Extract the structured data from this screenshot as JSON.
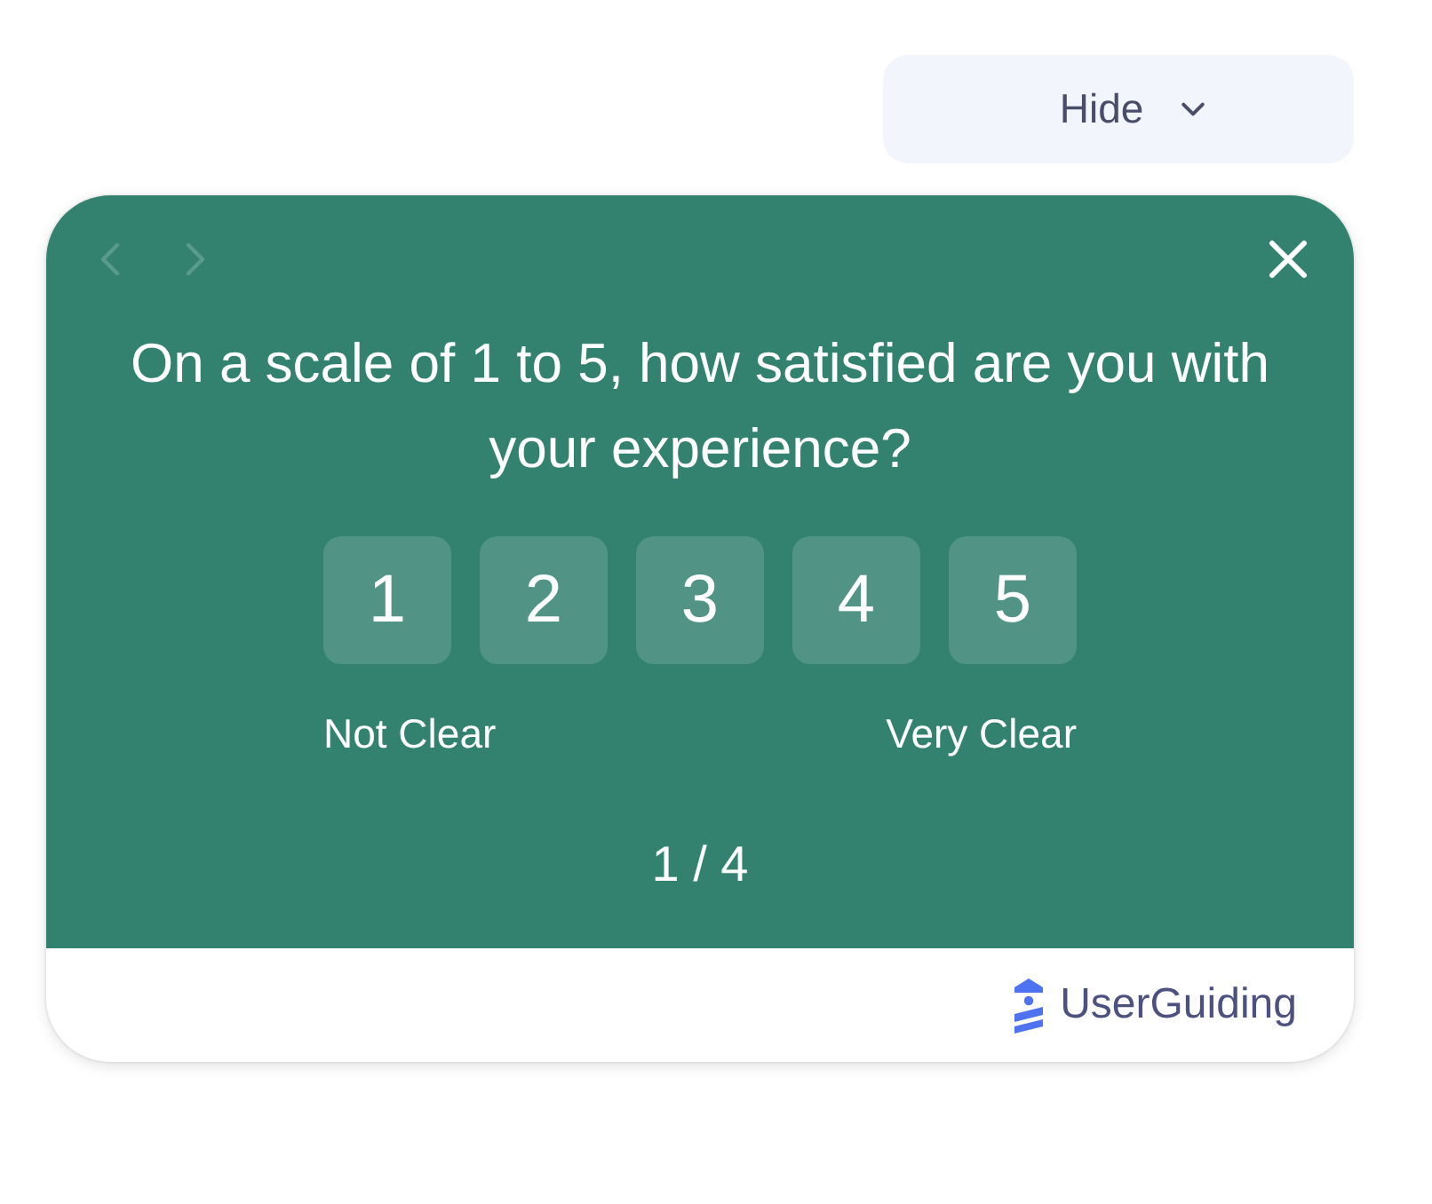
{
  "hide_button": {
    "label": "Hide"
  },
  "survey": {
    "nav": [
      {
        "kind": "previous",
        "disabled": true
      },
      {
        "kind": "next",
        "disabled": true
      }
    ],
    "question": "On a scale of 1 to 5, how satisfied are you with your experience?",
    "options": [
      {
        "label": "1",
        "selected": false
      },
      {
        "label": "2",
        "selected": false
      },
      {
        "label": "3",
        "selected": false
      },
      {
        "label": "4",
        "selected": false
      },
      {
        "label": "5",
        "selected": false
      }
    ],
    "scale_labels": {
      "low": "Not Clear",
      "high": "Very Clear"
    },
    "progress": "1 / 4"
  },
  "footer": {
    "brand": "UserGuiding"
  }
}
